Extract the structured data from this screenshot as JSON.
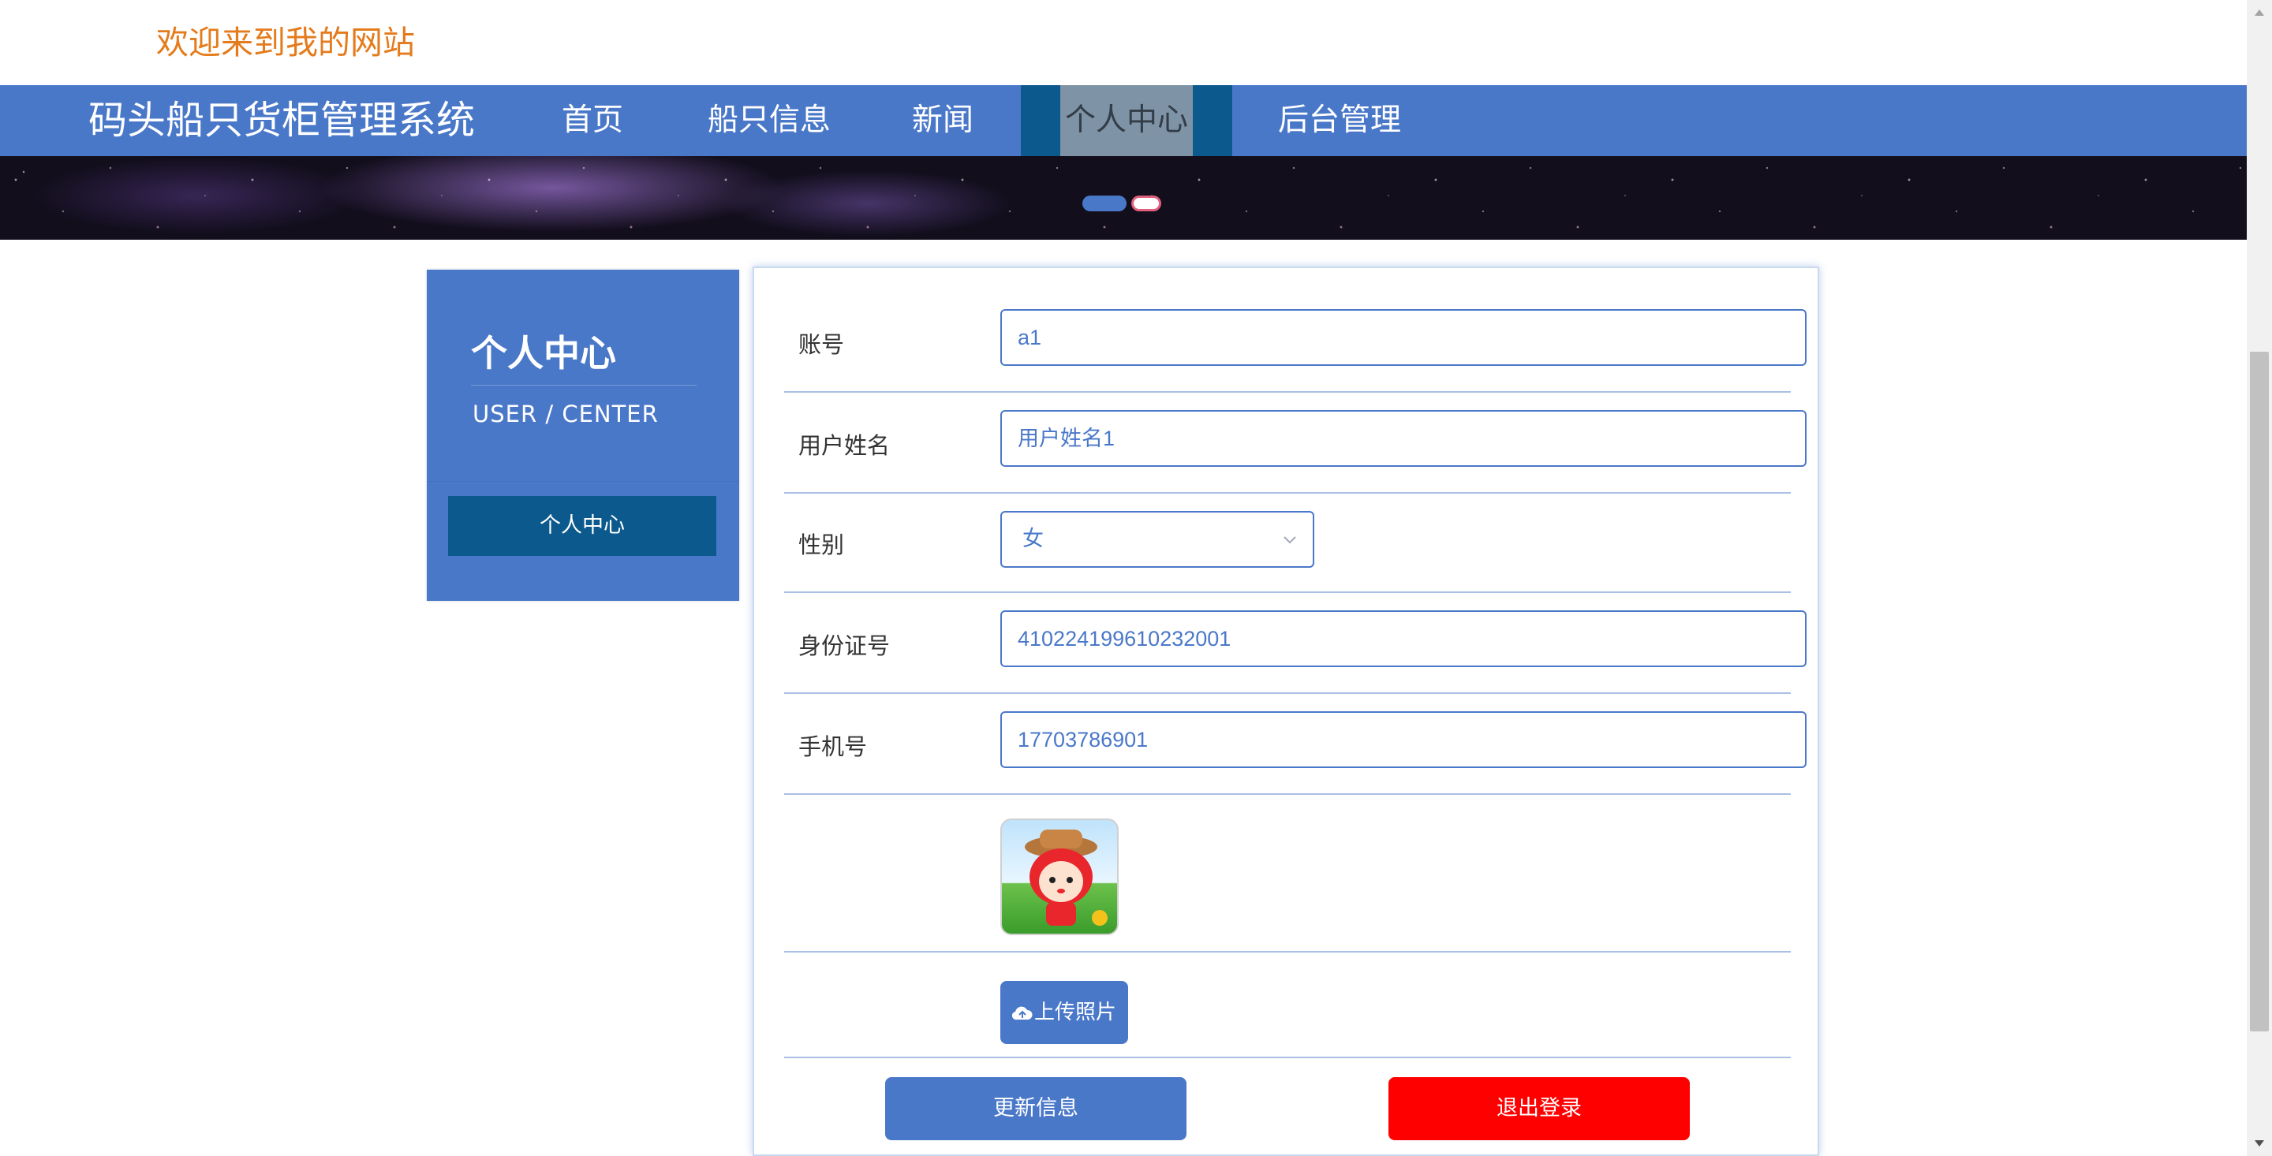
{
  "header": {
    "welcome": "欢迎来到我的网站"
  },
  "nav": {
    "site_title": "码头船只货柜管理系统",
    "items": [
      {
        "label": "首页",
        "active": false
      },
      {
        "label": "船只信息",
        "active": false
      },
      {
        "label": "新闻",
        "active": false
      },
      {
        "label": "个人中心",
        "active": true
      },
      {
        "label": "后台管理",
        "active": false
      }
    ]
  },
  "sidebar": {
    "title": "个人中心",
    "subtitle": "USER / CENTER",
    "menu_item": "个人中心"
  },
  "form": {
    "account": {
      "label": "账号",
      "value": "a1"
    },
    "name": {
      "label": "用户姓名",
      "value": "用户姓名1"
    },
    "gender": {
      "label": "性别",
      "value": "女"
    },
    "id_number": {
      "label": "身份证号",
      "value": "410224199610232001"
    },
    "phone": {
      "label": "手机号",
      "value": "17703786901"
    },
    "upload_label": "上传照片",
    "update_label": "更新信息",
    "logout_label": "退出登录"
  },
  "colors": {
    "primary": "#4a78c9",
    "active_nav": "#0c5a8d",
    "welcome_text": "#e47b1c",
    "danger": "#ff0000"
  },
  "icons": {
    "upload": "cloud-upload-icon",
    "select_chevron": "chevron-down-icon"
  }
}
